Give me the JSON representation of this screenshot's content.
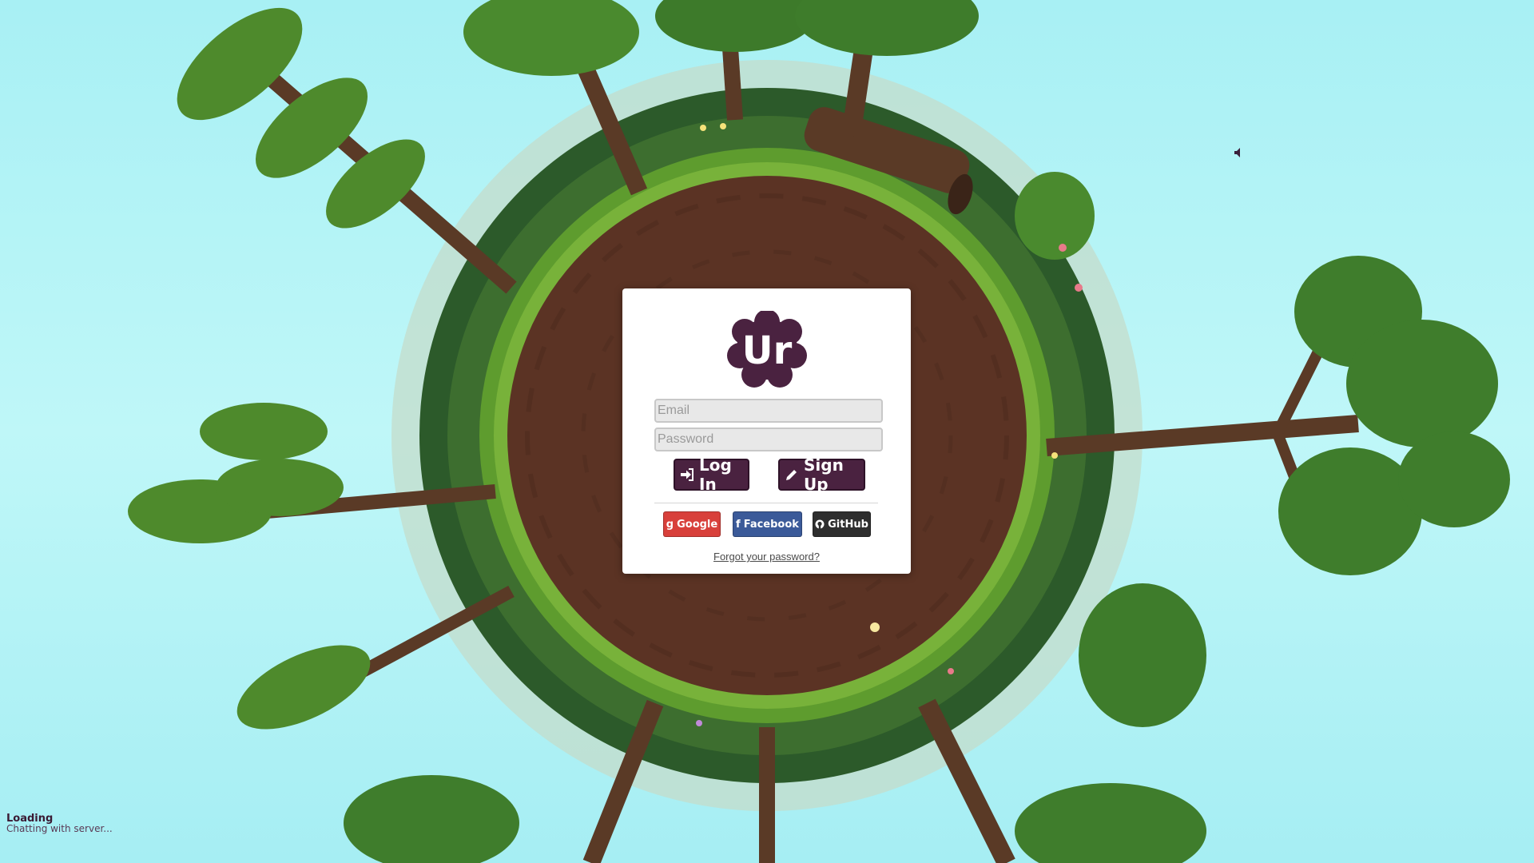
{
  "colors": {
    "sky": "#b3f3f6",
    "dirt": "#5b3324",
    "grass": "#5a9a2a",
    "brand_purple": "#4a2240",
    "google": "#d8403b",
    "facebook": "#3b5a99",
    "github": "#2e2e2e"
  },
  "logo": {
    "text": "Ur"
  },
  "login_form": {
    "email_placeholder": "Email",
    "password_placeholder": "Password",
    "login_label": "Log In",
    "signup_label": "Sign Up",
    "google_label": "Google",
    "facebook_label": "Facebook",
    "github_label": "GitHub",
    "forgot_label": "Forgot your password?"
  },
  "icons": {
    "login": "sign-in-icon",
    "signup": "pencil-icon",
    "google": "google-plus-icon",
    "facebook": "facebook-icon",
    "github": "github-icon",
    "sound": "speaker-icon"
  },
  "status": {
    "title": "Loading",
    "message": "Chatting with server..."
  }
}
